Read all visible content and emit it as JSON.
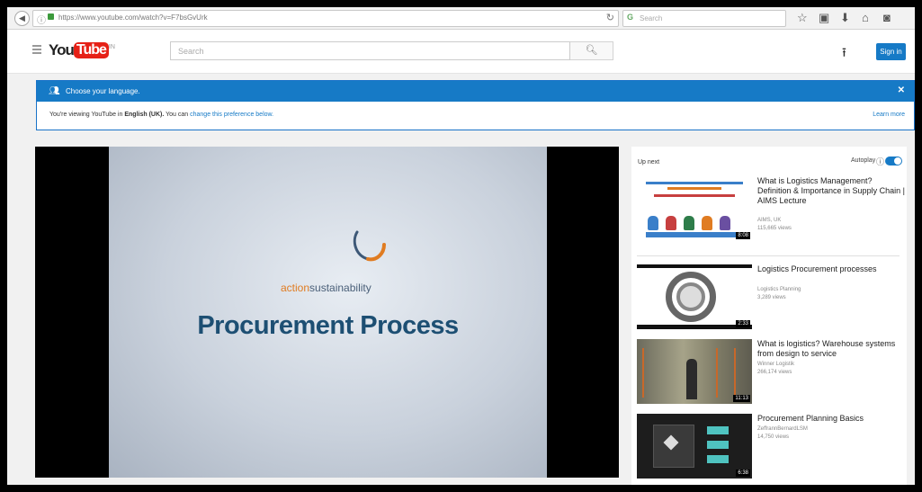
{
  "browser": {
    "url": "https://www.youtube.com/watch?v=F7bsGvUrk",
    "search_placeholder": "Search",
    "back_icon": "back-arrow-icon",
    "reload_icon": "reload-icon",
    "toolbar_icons": [
      "star-icon",
      "clipboard-icon",
      "download-icon",
      "home-icon",
      "pocket-icon"
    ]
  },
  "youtube": {
    "logo_you": "You",
    "logo_tube": "Tube",
    "logo_region": "IN",
    "search_placeholder": "Search",
    "sign_in_label": "Sign in",
    "brand_red": "#e62117",
    "brand_blue": "#167ac6"
  },
  "language_banner": {
    "title": "Choose your language.",
    "message_prefix": "You're viewing YouTube in",
    "language": "English (UK).",
    "message_mid": "You can",
    "change_link": "change this preference below.",
    "learn_more": "Learn more"
  },
  "player": {
    "brand_accent": "action",
    "brand_rest": "sustainability",
    "title": "Procurement Process"
  },
  "sidebar": {
    "up_next": "Up next",
    "autoplay_label": "Autoplay",
    "autoplay_on": true,
    "videos": [
      {
        "title": "What is Logistics Management? Definition & Importance in Supply Chain | AIMS Lecture",
        "channel": "AIMS, UK",
        "views": "115,665 views",
        "duration": "8:08"
      },
      {
        "title": "Logistics Procurement processes",
        "channel": "Logistics Planning",
        "views": "3,289 views",
        "duration": "2:33"
      },
      {
        "title": "What is logistics? Warehouse systems from design to service",
        "channel": "Winner Logistik",
        "views": "266,174 views",
        "duration": "11:13"
      },
      {
        "title": "Procurement Planning Basics",
        "channel": "ZeffrannBernardLSM",
        "views": "14,750 views",
        "duration": "6:38"
      }
    ]
  }
}
